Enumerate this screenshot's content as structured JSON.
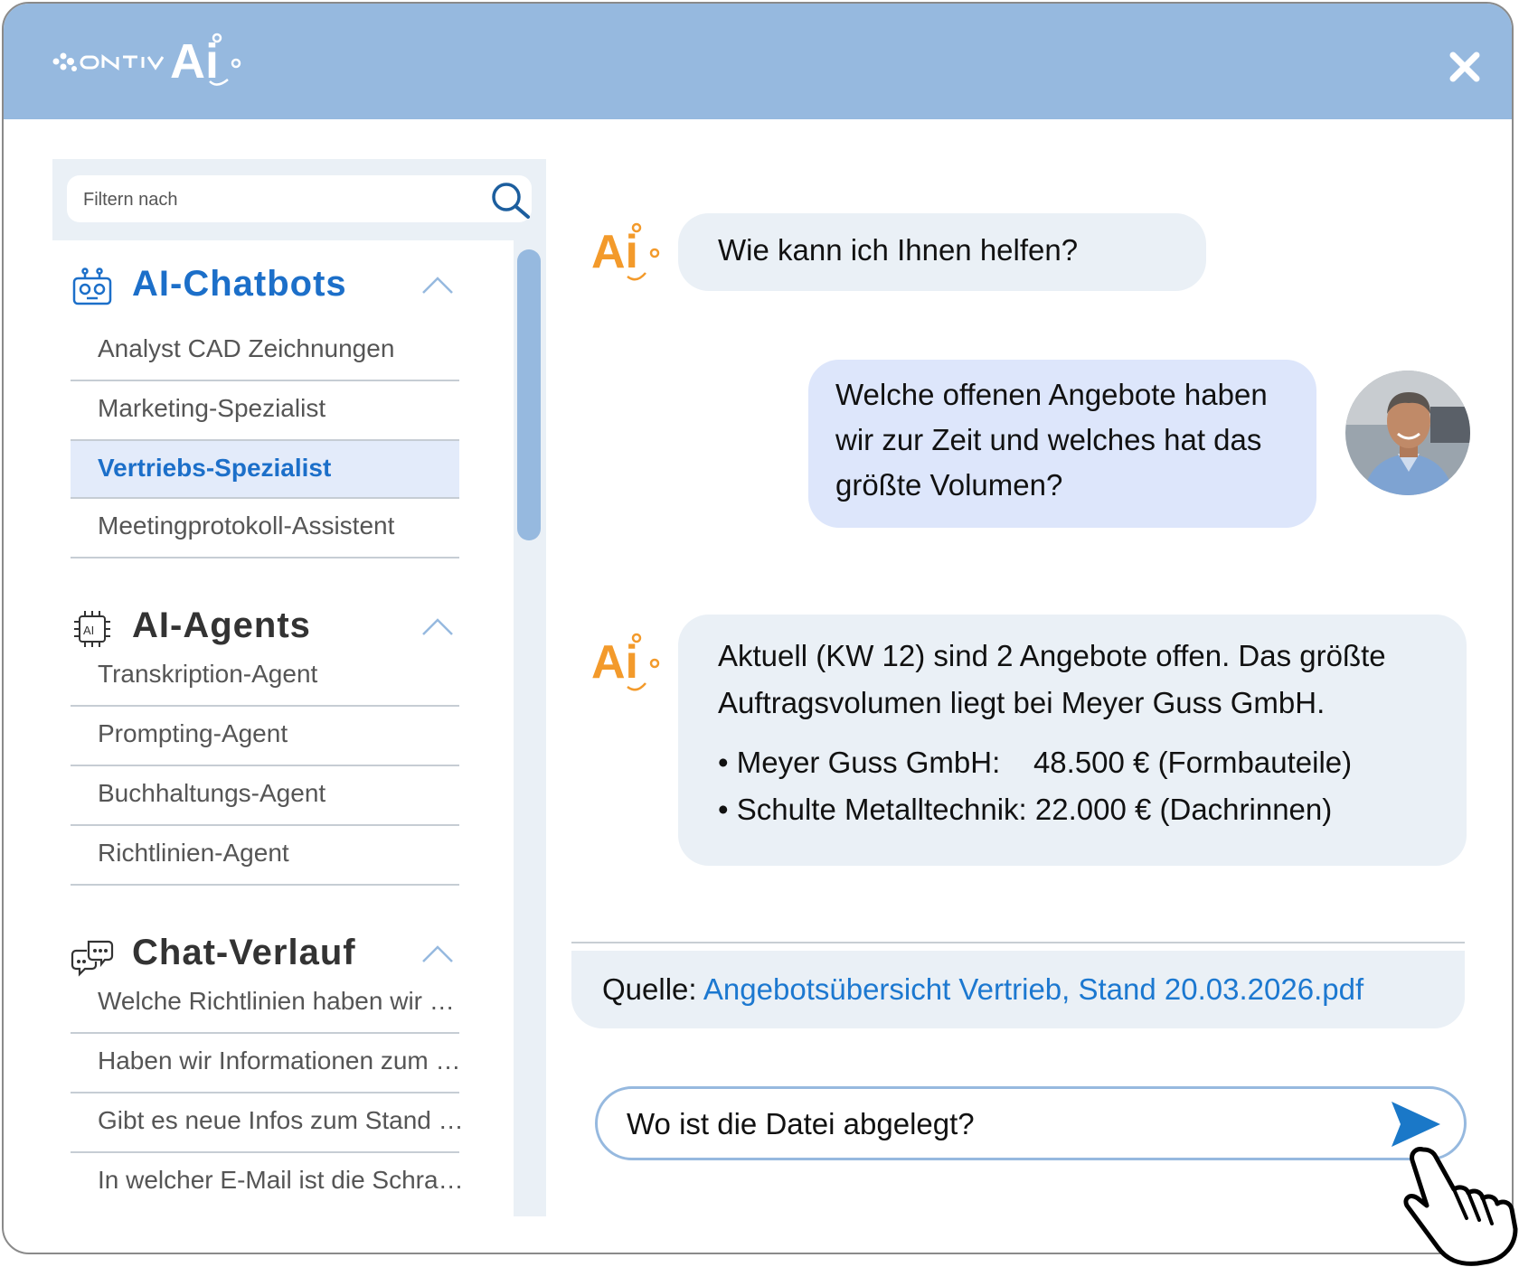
{
  "app": {
    "logo_text": "ontiv",
    "logo_ai": "Ai"
  },
  "search": {
    "placeholder": "Filtern nach"
  },
  "sidebar": {
    "sections": [
      {
        "title": "AI-Chatbots",
        "icon": "robot-icon",
        "color": "#1c6fc9",
        "items": [
          "Analyst CAD Zeichnungen",
          "Marketing-Spezialist",
          "Vertriebs-Spezialist",
          "Meetingprotokoll-Assistent"
        ],
        "active_item": "Vertriebs-Spezialist"
      },
      {
        "title": "AI-Agents",
        "icon": "ai-chip-icon",
        "color": "#333333",
        "items": [
          "Transkription-Agent",
          "Prompting-Agent",
          "Buchhaltungs-Agent",
          "Richtlinien-Agent"
        ]
      },
      {
        "title": "Chat-Verlauf",
        "icon": "chat-bubbles-icon",
        "color": "#333333",
        "items": [
          "Welche Richtlinien haben wir  …",
          "Haben wir Informationen zum …",
          "Gibt es neue Infos zum Stand …",
          "In welcher E-Mail ist die Schra…"
        ]
      }
    ]
  },
  "chat": {
    "greeting": "Wie kann ich Ihnen helfen?",
    "user_question_lines": [
      "Welche offenen Angebote haben",
      "wir zur Zeit und welches hat das",
      "größte Volumen?"
    ],
    "answer_lines": [
      "Aktuell (KW 12) sind 2 Angebote offen. Das größte",
      "Auftragsvolumen liegt bei Meyer Guss GmbH."
    ],
    "bullets": [
      "• Meyer Guss GmbH:    48.500 € (Formbauteile)",
      "• Schulte Metalltechnik: 22.000 € (Dachrinnen)"
    ],
    "source_label": "Quelle: ",
    "source_link": "Angebotsübersicht Vertrieb, Stand 20.03.2026.pdf"
  },
  "composer": {
    "value": "Wo ist die Datei abgelegt?"
  },
  "colors": {
    "titlebar": "#96b9df",
    "accent": "#1c6fc9",
    "ai_orange": "#f39a2b",
    "send": "#1a78c8"
  }
}
